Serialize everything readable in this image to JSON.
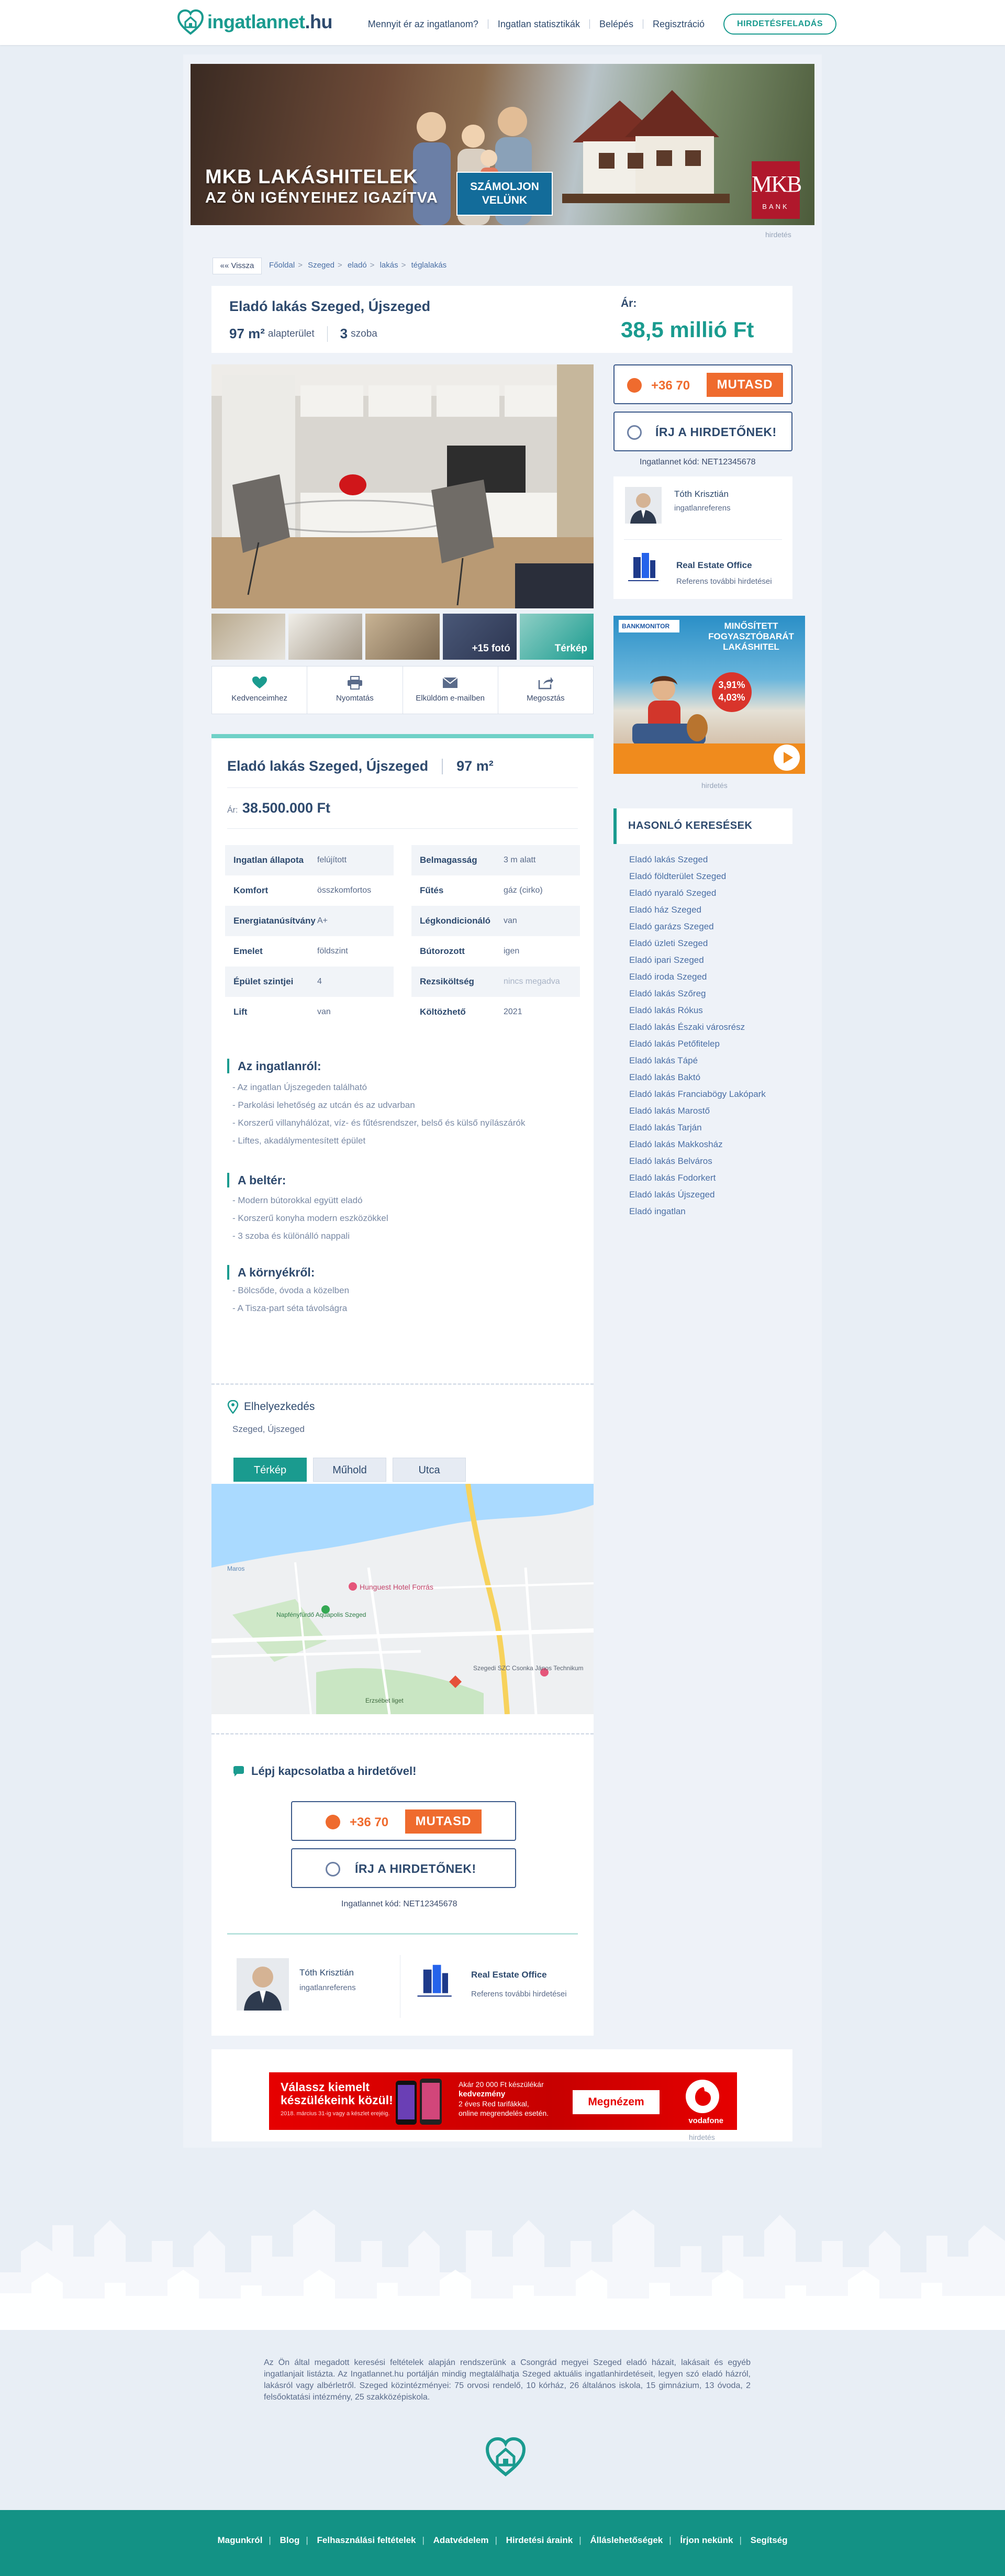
{
  "header": {
    "logo_main": "ingatlannet",
    "logo_tld": ".hu",
    "nav": [
      "Mennyit ér az ingatlanom?",
      "Ingatlan statisztikák",
      "Belépés",
      "Regisztráció"
    ],
    "cta": "HIRDETÉSFELADÁS"
  },
  "top_ad": {
    "headline_1": "MKB LAKÁSHITELEK",
    "headline_2": "AZ ÖN IGÉNYEIHEZ IGAZÍTVA",
    "button": "SZÁMOLJON VELÜNK",
    "bank_mark": "MKB",
    "bank_word": "BANK",
    "label": "hirdetés"
  },
  "breadcrumb": {
    "back": "«« Vissza",
    "items": [
      "Főoldal",
      "Szeged",
      "eladó",
      "lakás",
      "téglalakás"
    ]
  },
  "listing": {
    "title": "Eladó lakás Szeged, Újszeged",
    "area_value": "97 m²",
    "area_label": "alapterület",
    "rooms_value": "3",
    "rooms_label": "szoba",
    "price_label": "Ár:",
    "price_value": "38,5 millió Ft"
  },
  "gallery": {
    "more_photos": "+15 fotó",
    "map_thumb": "Térkép"
  },
  "actions": [
    "Kedvenceimhez",
    "Nyomtatás",
    "Elküldöm e-mailben",
    "Megosztás"
  ],
  "sidebar": {
    "phone": "+36 70",
    "show": "MUTASD",
    "message": "ÍRJ A HIRDETŐNEK!",
    "code": "Ingatlannet kód:  NET12345678",
    "agent_name": "Tóth Krisztián",
    "agent_role": "ingatlanreferens",
    "office_name": "Real Estate Office",
    "office_sub": "Referens további hirdetései",
    "ad_brand": "BANKMONITOR",
    "ad_text": "MINŐSÍTETT FOGYASZTÓBARÁT LAKÁSHITEL",
    "ad_rate_1": "3,91%",
    "ad_rate_2": "4,03%",
    "ad_label": "hirdetés",
    "similar_title": "HASONLÓ KERESÉSEK",
    "similar": [
      "Eladó lakás Szeged",
      "Eladó földterület Szeged",
      "Eladó nyaraló Szeged",
      "Eladó ház Szeged",
      "Eladó garázs Szeged",
      "Eladó üzleti Szeged",
      "Eladó ipari Szeged",
      "Eladó iroda Szeged",
      "Eladó lakás Szőreg",
      "Eladó lakás Rókus",
      "Eladó lakás Északi városrész",
      "Eladó lakás Petőfitelep",
      "Eladó lakás Tápé",
      "Eladó lakás Baktó",
      "Eladó lakás Franciabögy Lakópark",
      "Eladó lakás Marostő",
      "Eladó lakás Tarján",
      "Eladó lakás Makkosház",
      "Eladó lakás Belváros",
      "Eladó lakás Fodorkert",
      "Eladó lakás Újszeged",
      "Eladó ingatlan"
    ]
  },
  "details": {
    "title": "Eladó lakás Szeged,  Újszeged",
    "area": "97 m²",
    "price_prefix": "Ár:",
    "price": "38.500.000 Ft",
    "left_props": [
      {
        "k": "Ingatlan állapota",
        "v": "felújított"
      },
      {
        "k": "Komfort",
        "v": "összkomfortos"
      },
      {
        "k": "Energiatanúsítvány",
        "v": "A+"
      },
      {
        "k": "Emelet",
        "v": "földszint"
      },
      {
        "k": "Épület szintjei",
        "v": "4"
      },
      {
        "k": "Lift",
        "v": "van"
      }
    ],
    "right_props": [
      {
        "k": "Belmagasság",
        "v": "3 m alatt"
      },
      {
        "k": "Fűtés",
        "v": "gáz (cirko)"
      },
      {
        "k": "Légkondicionáló",
        "v": "van"
      },
      {
        "k": "Bútorozott",
        "v": "igen"
      },
      {
        "k": "Rezsiköltség",
        "v": "nincs megadva"
      },
      {
        "k": "Költözhető",
        "v": "2021"
      }
    ],
    "sections": [
      {
        "title": "Az ingatlanról:",
        "items": [
          "- Az  ingatlan Újszegeden található",
          "- Parkolási lehetőség az utcán és az udvarban",
          "- Korszerű villanyhálózat, víz- és fűtésrendszer, belső és külső nyílászárók",
          "- Liftes, akadálymentesített épület"
        ]
      },
      {
        "title": "A beltér:",
        "items": [
          "- Modern bútorokkal együtt eladó",
          "- Korszerű konyha modern eszközökkel",
          "- 3 szoba és különálló nappali"
        ]
      },
      {
        "title": "A környékről:",
        "items": [
          "- Bölcsőde, óvoda a közelben",
          "- A Tisza-part séta távolságra"
        ]
      }
    ],
    "location_title": "Elhelyezkedés",
    "location_sub": "Szeged, Újszeged",
    "map_tabs": [
      "Térkép",
      "Műhold",
      "Utca"
    ],
    "map_labels": {
      "hotel": "Hunguest Hotel Forrás",
      "aqua": "Napfényfürdő Aquapolis Szeged",
      "school": "Szegedi SZC Csonka János Technikum",
      "park": "Erzsébet liget",
      "water": "Maros"
    },
    "contact_title": "Lépj kapcsolatba a hirdetővel!",
    "phone": "+36 70",
    "show": "MUTASD",
    "message": "ÍRJ A HIRDETŐNEK!",
    "code": "Ingatlannet kód:  NET12345678",
    "agent_name": "Tóth Krisztián",
    "agent_role": "ingatlanreferens",
    "office_name": "Real Estate Office",
    "office_sub": "Referens további hirdetései"
  },
  "bottom_ad": {
    "headline_1": "Válassz kiemelt",
    "headline_2": "készülékeink közül!",
    "small": "2018. március 31-ig vagy a készlet erejéig.",
    "mid_1": "Akár 20 000 Ft készülékár",
    "mid_2": "kedvezmény",
    "mid_3": "2 éves Red tarifákkal,",
    "mid_4": "online megrendelés esetén.",
    "button": "Megnézem",
    "brand": "vodafone",
    "label": "hirdetés"
  },
  "footer": {
    "text": "Az Ön által megadott keresési feltételek alapján rendszerünk a Csongrád megyei Szeged eladó házait, lakásait és egyéb ingatlanjait listázta. Az Ingatlannet.hu portálján mindig megtalálhatja Szeged aktuális ingatlanhirdetéseit, legyen szó eladó házról, lakásról vagy albérletről. Szeged közintézményei: 75 orvosi rendelő, 10 kórház, 26 általános iskola, 15 gimnázium, 13 óvoda, 2 felsőoktatási intézmény, 25 szakközépiskola.",
    "links": [
      "Magunkról",
      "Blog",
      "Felhasználási feltételek",
      "Adatvédelem",
      "Hirdetési áraink",
      "Álláslehetőségek",
      "Írjon nekünk",
      "Segítség"
    ]
  },
  "colors": {
    "brand": "#1a9b8f",
    "navy": "#2e4a6e",
    "orange": "#ef6b2e",
    "footer": "#139285"
  }
}
